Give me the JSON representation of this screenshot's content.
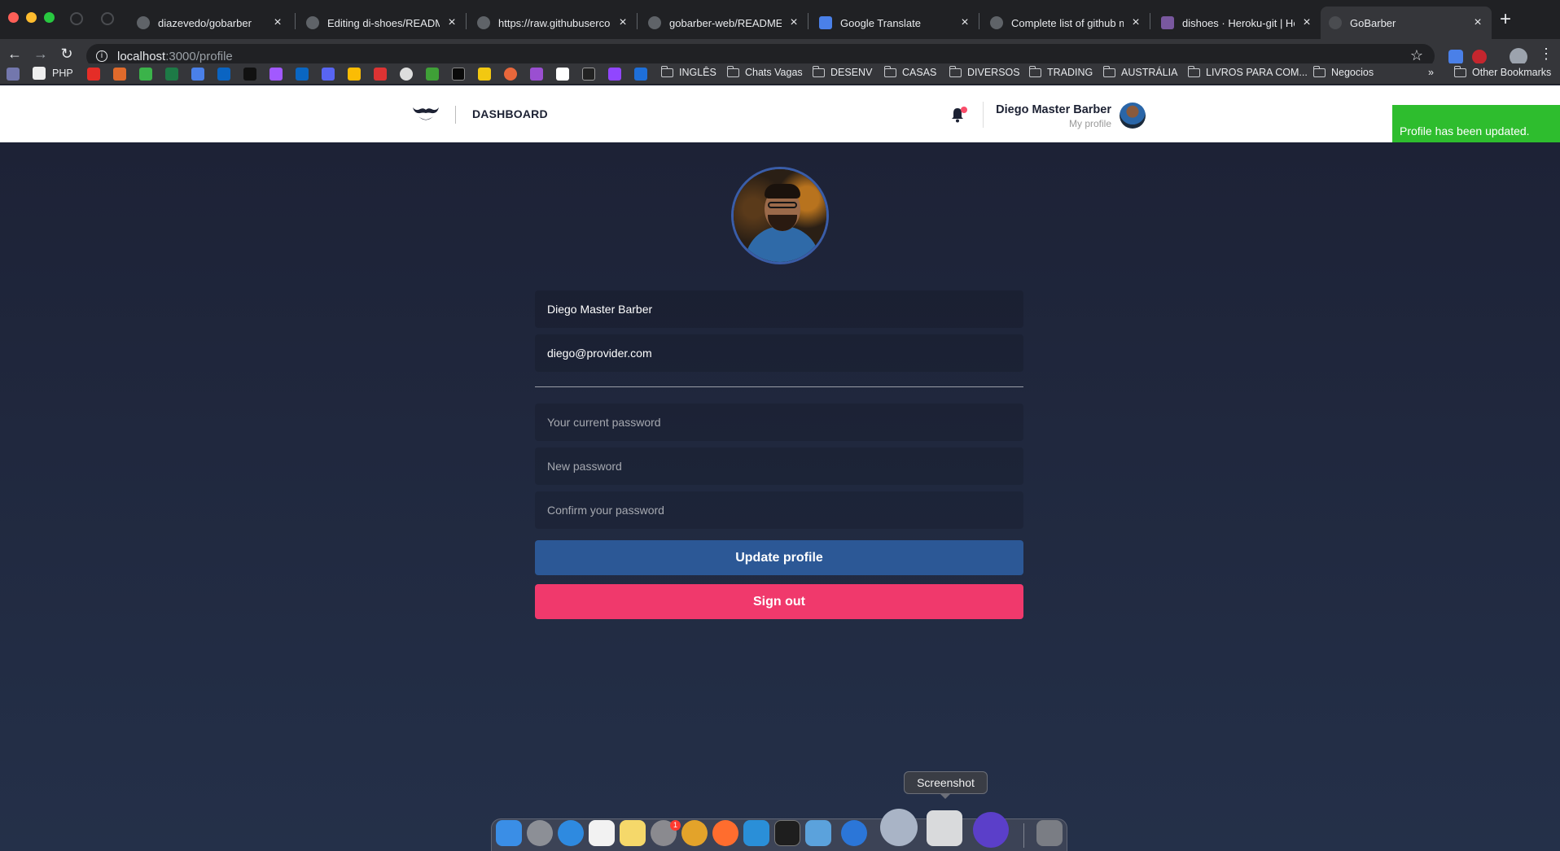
{
  "browser": {
    "tabs": [
      {
        "title": "diazevedo/gobarber"
      },
      {
        "title": "Editing di-shoes/README.m"
      },
      {
        "title": "https://raw.githubuserconte"
      },
      {
        "title": "gobarber-web/README.md"
      },
      {
        "title": "Google Translate"
      },
      {
        "title": "Complete list of github mar"
      },
      {
        "title": "dishoes · Heroku-git | Hero"
      },
      {
        "title": "GoBarber"
      }
    ],
    "url_host": "localhost",
    "url_path": ":3000/profile",
    "bookmarks": {
      "php": "PHP",
      "folders": [
        "INGLÊS",
        "Chats Vagas",
        "DESENV",
        "CASAS",
        "DIVERSOS",
        "TRADING",
        "AUSTRÁLIA",
        "LIVROS PARA COM...",
        "Negocios"
      ],
      "other": "Other Bookmarks"
    }
  },
  "header": {
    "nav_label": "DASHBOARD",
    "user_name": "Diego Master Barber",
    "user_link": "My profile"
  },
  "form": {
    "name_value": "Diego Master Barber",
    "email_value": "diego@provider.com",
    "current_password_placeholder": "Your current password",
    "new_password_placeholder": "New password",
    "confirm_password_placeholder": "Confirm your password",
    "update_label": "Update profile",
    "signout_label": "Sign out"
  },
  "toast": {
    "message": "Profile has been updated.",
    "color": "#2ebd2e"
  },
  "dock": {
    "tooltip": "Screenshot",
    "settings_badge": "1"
  },
  "colors": {
    "background": "#1c2133",
    "update_button": "#2c5896",
    "signout_button": "#f0396c",
    "notification_dot": "#f94d6a"
  }
}
